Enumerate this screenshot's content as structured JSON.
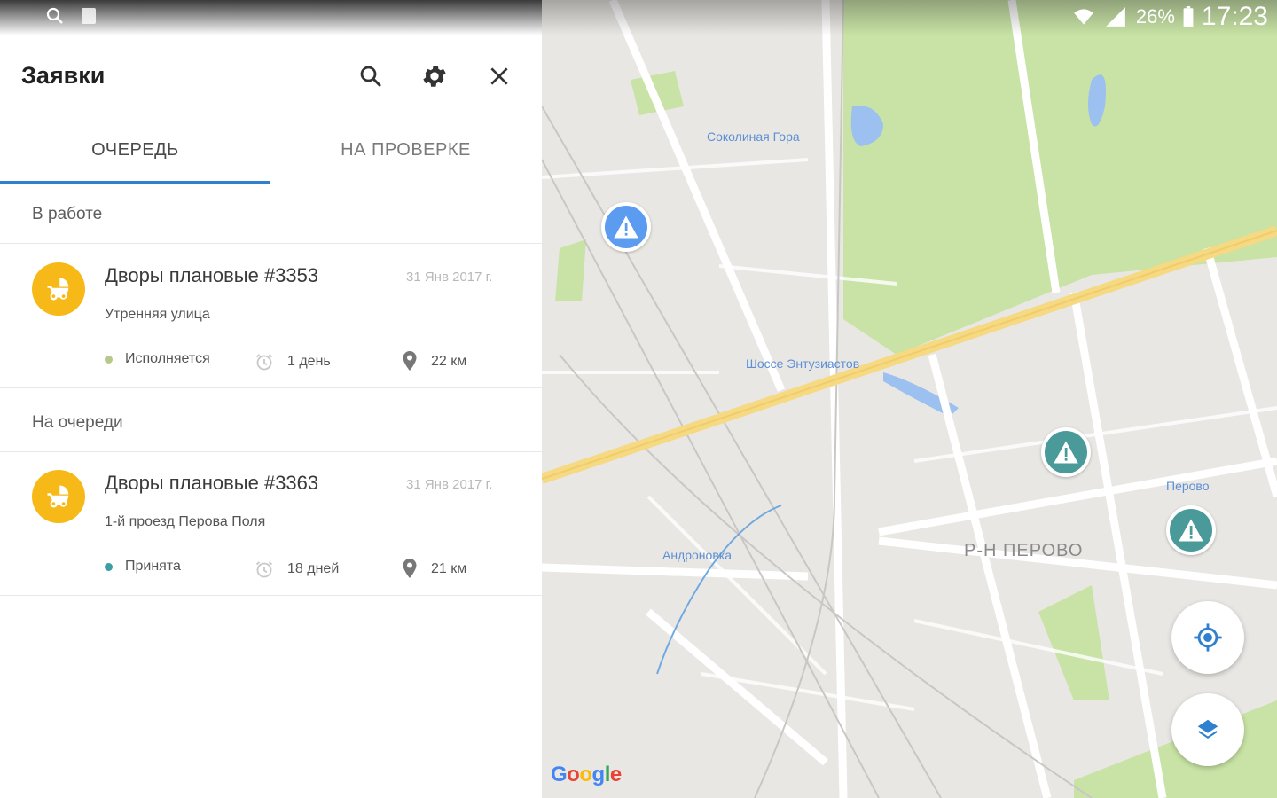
{
  "status_bar": {
    "battery_percent": "26%",
    "time": "17:23"
  },
  "header": {
    "title": "Заявки",
    "icons": [
      "search-icon",
      "gear-icon",
      "close-icon"
    ]
  },
  "tabs": [
    {
      "label": "ОЧЕРЕДЬ",
      "active": true
    },
    {
      "label": "НА ПРОВЕРКЕ",
      "active": false
    }
  ],
  "sections": [
    {
      "title": "В работе",
      "items": [
        {
          "title": "Дворы плановые #3353",
          "date": "31 Янв 2017 г.",
          "address": "Утренняя улица",
          "status": "Исполняется",
          "status_color": "#b7c98a",
          "duration": "1 день",
          "distance": "22 км",
          "icon": "stroller-icon"
        }
      ]
    },
    {
      "title": "На очереди",
      "items": [
        {
          "title": "Дворы плановые #3363",
          "date": "31 Янв 2017 г.",
          "address": "1-й проезд Перова Поля",
          "status": "Принята",
          "status_color": "#3a9ea5",
          "duration": "18 дней",
          "distance": "21 км",
          "icon": "stroller-icon"
        }
      ]
    }
  ],
  "colors": {
    "accent": "#2f80d1",
    "avatar": "#f6b917",
    "marker_blue": "#5b9bf0",
    "marker_teal": "#4a9a9a"
  },
  "map": {
    "labels": {
      "sokolinaya": "Соколиная Гора",
      "shosse": "Шоссе Энтузиастов",
      "perovo_station": "Перово",
      "andronovka": "Андроновка",
      "district": "Р-Н ПЕРОВО"
    },
    "brand": "Google"
  }
}
